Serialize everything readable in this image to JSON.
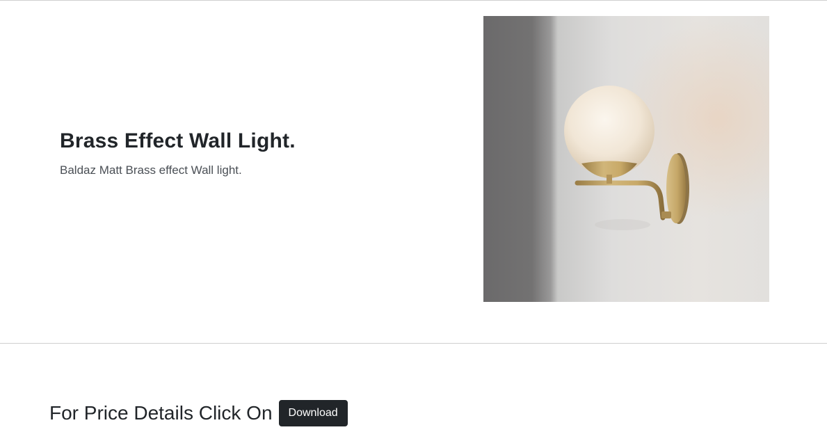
{
  "product": {
    "title": "Brass Effect Wall Light.",
    "description": "Baldaz Matt Brass effect Wall light.",
    "image_subject": "brass wall light with opal glass globe"
  },
  "cta": {
    "text": "For Price Details Click On",
    "button_label": "Download",
    "button_color": "#212529"
  }
}
